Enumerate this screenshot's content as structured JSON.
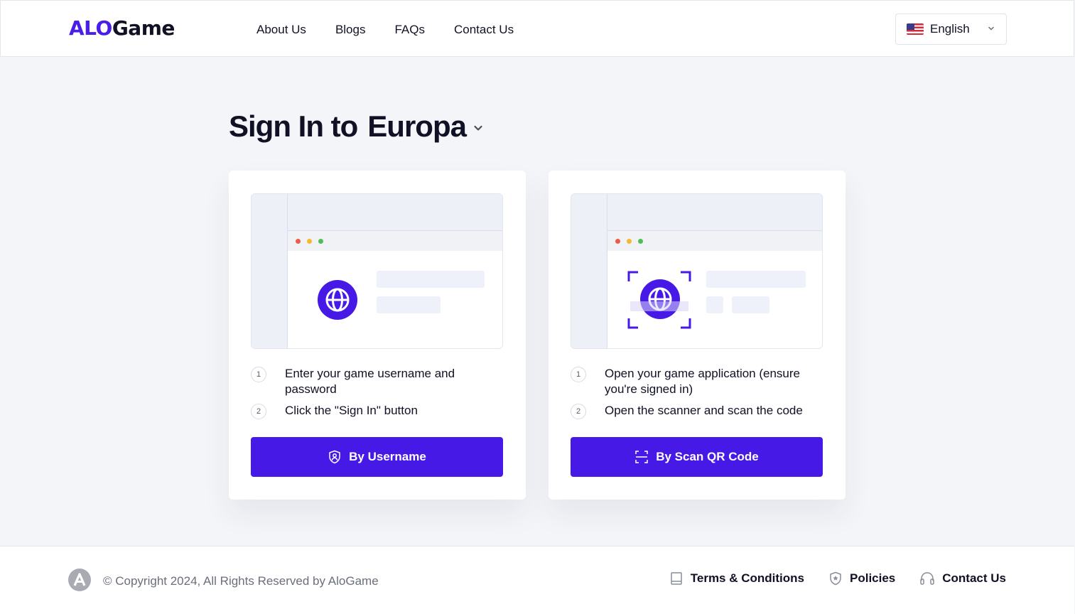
{
  "header": {
    "logo": {
      "part1": "ALO",
      "part2": "Game"
    },
    "nav": [
      {
        "label": "About Us"
      },
      {
        "label": "Blogs"
      },
      {
        "label": "FAQs"
      },
      {
        "label": "Contact Us"
      }
    ],
    "language": {
      "label": "English",
      "flag": "us-flag-icon"
    }
  },
  "main": {
    "title_prefix": "Sign In to",
    "server": "Europa",
    "cards": [
      {
        "steps": [
          {
            "num": "1",
            "text": "Enter your game username and password"
          },
          {
            "num": "2",
            "text": "Click the \"Sign In\" button"
          }
        ],
        "button_label": "By Username",
        "button_icon": "shield-user-icon"
      },
      {
        "steps": [
          {
            "num": "1",
            "text": "Open your game application (ensure you're signed in)"
          },
          {
            "num": "2",
            "text": "Open the scanner and scan the code"
          }
        ],
        "button_label": "By Scan QR Code",
        "button_icon": "scan-icon"
      }
    ]
  },
  "footer": {
    "copyright": "© Copyright 2024, All Rights Reserved by AloGame",
    "links": [
      {
        "label": "Terms & Conditions",
        "icon": "document-icon"
      },
      {
        "label": "Policies",
        "icon": "shield-star-icon"
      },
      {
        "label": "Contact Us",
        "icon": "headphones-icon"
      }
    ]
  },
  "colors": {
    "accent": "#4619e6",
    "text": "#101124",
    "background": "#f4f5f8"
  }
}
